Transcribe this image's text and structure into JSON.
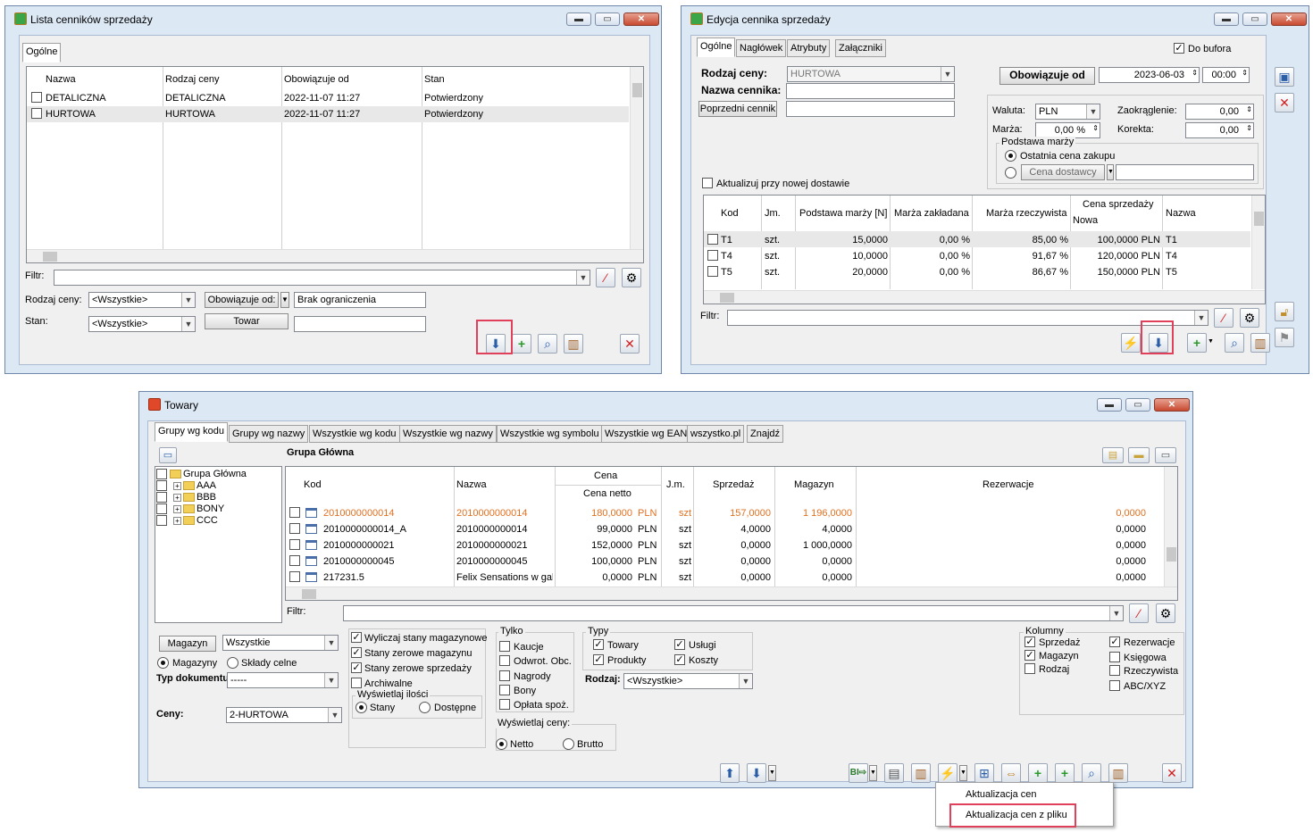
{
  "w1": {
    "title": "Lista cenników sprzedaży",
    "tab": "Ogólne",
    "columns": [
      "Nazwa",
      "Rodzaj ceny",
      "Obowiązuje od",
      "Stan"
    ],
    "rows": [
      [
        "DETALICZNA",
        "DETALICZNA",
        "2022-11-07 11:27",
        "Potwierdzony"
      ],
      [
        "HURTOWA",
        "HURTOWA",
        "2022-11-07 11:27",
        "Potwierdzony"
      ]
    ],
    "filter_label": "Filtr:",
    "rodzaj_label": "Rodzaj ceny:",
    "rodzaj_value": "<Wszystkie>",
    "obowiazuje_btn": "Obowiązuje od:",
    "obowiazuje_value": "Brak ograniczenia",
    "stan_label": "Stan:",
    "stan_value": "<Wszystkie>",
    "towar_btn": "Towar"
  },
  "w2": {
    "title": "Edycja cennika sprzedaży",
    "tabs": [
      "Ogólne",
      "Nagłówek",
      "Atrybuty",
      "Załączniki"
    ],
    "do_bufora": "Do bufora",
    "rodzaj_label": "Rodzaj ceny:",
    "rodzaj_value": "HURTOWA",
    "nazwa_label": "Nazwa cennika:",
    "poprzedni_btn": "Poprzedni cennik",
    "obowiazuje_btn": "Obowiązuje od",
    "date": "2023-06-03",
    "time": "00:00",
    "waluta_label": "Waluta:",
    "waluta_value": "PLN",
    "zaokraglenie_label": "Zaokrąglenie:",
    "zaokraglenie_value": "0,00",
    "marza_label": "Marża:",
    "marza_value": "0,00 %",
    "korekta_label": "Korekta:",
    "korekta_value": "0,00",
    "podstawa_label": "Podstawa marży",
    "ostatnia": "Ostatnia cena zakupu",
    "cena_dostawcy": "Cena dostawcy",
    "aktualizuj": "Aktualizuj przy nowej dostawie",
    "columns": [
      "Kod",
      "Jm.",
      "Podstawa marży [N]",
      "Marża zakładana",
      "Marża rzeczywista",
      "Cena sprzedaży",
      "Nowa",
      "Nazwa"
    ],
    "rows": [
      [
        "T1",
        "szt.",
        "15,0000",
        "0,00 %",
        "85,00 %",
        "100,0000 PLN",
        "T1"
      ],
      [
        "T4",
        "szt.",
        "10,0000",
        "0,00 %",
        "91,67 %",
        "120,0000 PLN",
        "T4"
      ],
      [
        "T5",
        "szt.",
        "20,0000",
        "0,00 %",
        "86,67 %",
        "150,0000 PLN",
        "T5"
      ]
    ],
    "filter_label": "Filtr:"
  },
  "w3": {
    "title": "Towary",
    "tabs": [
      "Grupy wg kodu",
      "Grupy wg nazwy",
      "Wszystkie wg kodu",
      "Wszystkie wg nazwy",
      "Wszystkie wg symbolu",
      "Wszystkie wg EAN",
      "wszystko.pl",
      "Znajdź"
    ],
    "tree": [
      "Grupa Główna",
      "AAA",
      "BBB",
      "BONY",
      "CCC"
    ],
    "group_header": "Grupa Główna",
    "columns": {
      "kod": "Kod",
      "nazwa": "Nazwa",
      "cena": "Cena",
      "cena_netto": "Cena netto",
      "jm": "J.m.",
      "sprzedaz": "Sprzedaż",
      "magazyn": "Magazyn",
      "rezerwacje": "Rezerwacje"
    },
    "rows": [
      {
        "kod": "2010000000014",
        "nazwa": "2010000000014",
        "cena": "180,0000",
        "waluta": "PLN",
        "jm": "szt",
        "sprzedaz": "157,0000",
        "magazyn": "1 196,0000",
        "rez": "0,0000"
      },
      {
        "kod": "2010000000014_A",
        "nazwa": "2010000000014",
        "cena": "99,0000",
        "waluta": "PLN",
        "jm": "szt",
        "sprzedaz": "4,0000",
        "magazyn": "4,0000",
        "rez": "0,0000"
      },
      {
        "kod": "2010000000021",
        "nazwa": "2010000000021",
        "cena": "152,0000",
        "waluta": "PLN",
        "jm": "szt",
        "sprzedaz": "0,0000",
        "magazyn": "1 000,0000",
        "rez": "0,0000"
      },
      {
        "kod": "2010000000045",
        "nazwa": "2010000000045",
        "cena": "100,0000",
        "waluta": "PLN",
        "jm": "szt",
        "sprzedaz": "0,0000",
        "magazyn": "0,0000",
        "rez": "0,0000"
      },
      {
        "kod": "217231.5",
        "nazwa": "Felix Sensations w gala",
        "cena": "0,0000",
        "waluta": "PLN",
        "jm": "szt",
        "sprzedaz": "0,0000",
        "magazyn": "0,0000",
        "rez": "0,0000"
      }
    ],
    "highlight_color": "#e07020",
    "filter_label": "Filtr:",
    "magazyn_btn": "Magazyn",
    "magazyn_value": "Wszystkie",
    "radio_magazyny": "Magazyny",
    "radio_sklady": "Składy celne",
    "typ_dok_label": "Typ dokumentu:",
    "typ_dok_value": "-----",
    "ceny_label": "Ceny:",
    "ceny_value": "2-HURTOWA",
    "checks": [
      "Wyliczaj stany magazynowe",
      "Stany zerowe magazynu",
      "Stany zerowe sprzedaży",
      "Archiwalne"
    ],
    "wyswietlaj_ilosci": "Wyświetlaj ilości",
    "stany": "Stany",
    "dostepne": "Dostępne",
    "tylko_label": "Tylko",
    "tylko": [
      "Kaucje",
      "Odwrot. Obc.",
      "Nagrody",
      "Bony",
      "Opłata spoż."
    ],
    "typy_label": "Typy",
    "typy": [
      "Towary",
      "Usługi",
      "Produkty",
      "Koszty"
    ],
    "rodzaj_label": "Rodzaj:",
    "rodzaj_value": "<Wszystkie>",
    "wyswietlaj_ceny": "Wyświetlaj ceny:",
    "netto": "Netto",
    "brutto": "Brutto",
    "kolumny_label": "Kolumny",
    "kolumny": [
      "Sprzedaż",
      "Rezerwacje",
      "Magazyn",
      "Księgowa",
      "Rodzaj",
      "Rzeczywista",
      "ABC/XYZ"
    ],
    "menu": [
      "Aktualizacja cen",
      "Aktualizacja cen z pliku"
    ]
  }
}
